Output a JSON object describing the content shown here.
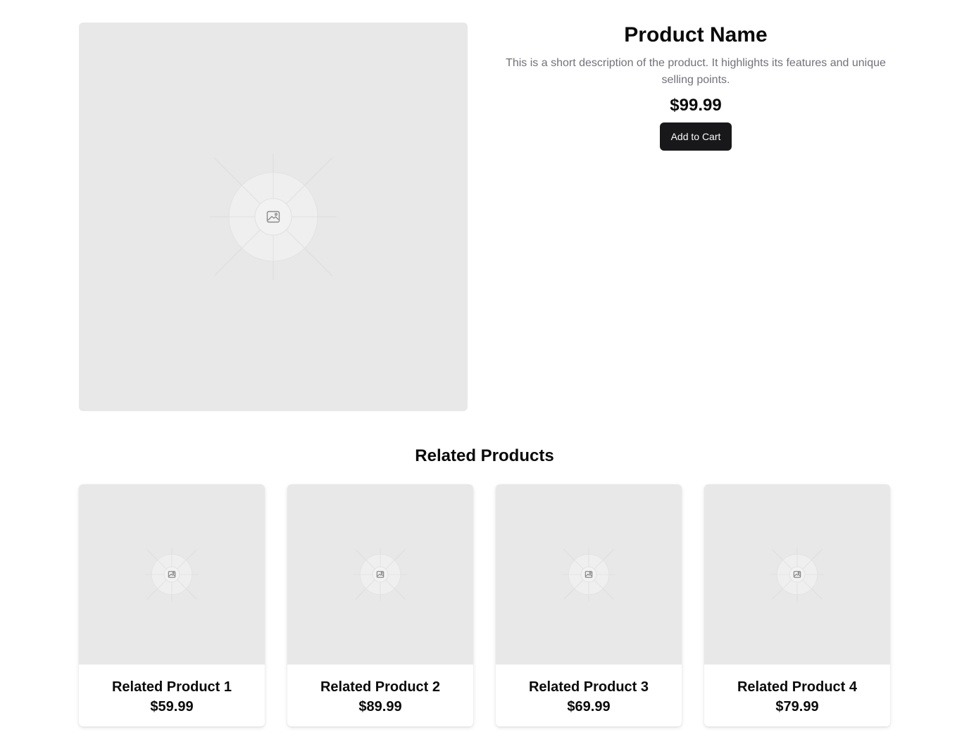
{
  "product": {
    "image_icon": "image-placeholder-icon",
    "title": "Product Name",
    "description": "This is a short description of the product. It highlights its features and unique selling points.",
    "price": "$99.99",
    "cart_button_label": "Add to Cart"
  },
  "related": {
    "heading": "Related Products",
    "items": [
      {
        "title": "Related Product 1",
        "price": "$59.99"
      },
      {
        "title": "Related Product 2",
        "price": "$89.99"
      },
      {
        "title": "Related Product 3",
        "price": "$69.99"
      },
      {
        "title": "Related Product 4",
        "price": "$79.99"
      }
    ]
  },
  "colors": {
    "image_background": "#e8e8e8",
    "button_background": "#18181b",
    "description_text": "#71717a"
  }
}
